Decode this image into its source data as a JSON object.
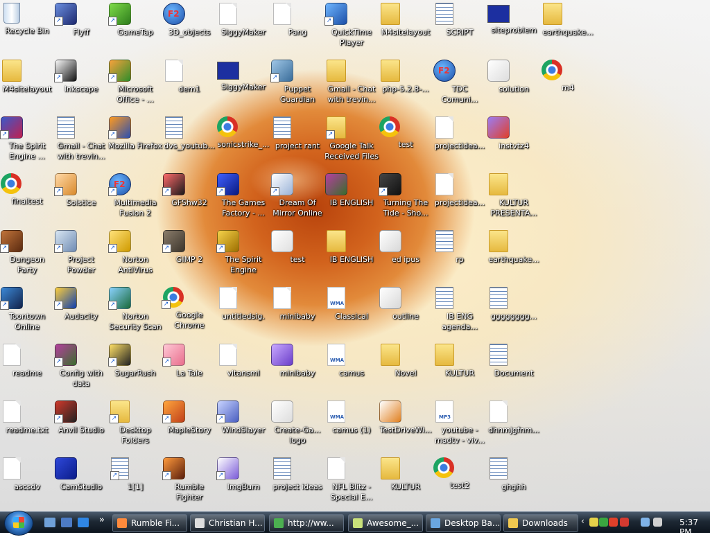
{
  "desktop": {
    "icons": [
      {
        "label": "Recycle Bin",
        "icon": "recycle-bin-icon",
        "type": "trash"
      },
      {
        "label": "Flyff",
        "icon": "flyff-icon",
        "type": "app",
        "c1": "#6b8fe0",
        "c2": "#1e2a70",
        "shortcut": true
      },
      {
        "label": "GameTap",
        "icon": "gametap-icon",
        "type": "app",
        "c1": "#7fdc4a",
        "c2": "#2e7d1c",
        "shortcut": true
      },
      {
        "label": "3D_objects",
        "icon": "multimedia-fusion-icon",
        "type": "f2"
      },
      {
        "label": "SiggyMaker",
        "icon": "file-icon",
        "type": "doc"
      },
      {
        "label": "Pang",
        "icon": "file-icon",
        "type": "doc"
      },
      {
        "label": "QuickTime Player",
        "icon": "quicktime-icon",
        "type": "app",
        "c1": "#6fb6ff",
        "c2": "#1b4fa8",
        "shortcut": true
      },
      {
        "label": "M4sitelayout",
        "icon": "zip-folder-icon",
        "type": "folder"
      },
      {
        "label": "SCRIPT",
        "icon": "text-document-icon",
        "type": "text"
      },
      {
        "label": "siteproblem",
        "icon": "bitmap-image-icon",
        "type": "dlg"
      },
      {
        "label": "earthquake...",
        "icon": "folder-icon",
        "type": "folder"
      },
      {
        "label": "M4sitelayout",
        "icon": "zip-folder-icon",
        "type": "folder"
      },
      {
        "label": "Inkscape",
        "icon": "inkscape-icon",
        "type": "app",
        "c1": "#fafafa",
        "c2": "#111111",
        "shortcut": true
      },
      {
        "label": "Microsoft Office - ...",
        "icon": "office-icon",
        "type": "app",
        "c1": "#f8a23c",
        "c2": "#2f8d2a",
        "shortcut": true
      },
      {
        "label": "dem1",
        "icon": "file-icon",
        "type": "doc"
      },
      {
        "label": "SiggyMaker",
        "icon": "siggymaker-icon",
        "type": "dlg"
      },
      {
        "label": "Puppet Guardian",
        "icon": "puppet-guardian-icon",
        "type": "app",
        "c1": "#9fc6e6",
        "c2": "#3a6d9a",
        "shortcut": true
      },
      {
        "label": "Gmail - Chat with trevin...",
        "icon": "zip-folder-icon",
        "type": "folder"
      },
      {
        "label": "php-5.2.8-...",
        "icon": "zip-folder-icon",
        "type": "folder"
      },
      {
        "label": "TDC Comuni...",
        "icon": "multimedia-fusion-icon",
        "type": "f2"
      },
      {
        "label": "solution",
        "icon": "bitmap-image-icon",
        "type": "app",
        "c1": "#ffffff",
        "c2": "#dddddd"
      },
      {
        "label": "m4",
        "icon": "chrome-icon",
        "type": "chrome"
      },
      {
        "label": "The Spirit Engine ...",
        "icon": "spirit-engine-icon",
        "type": "app",
        "c1": "#3b58c9",
        "c2": "#c02050",
        "shortcut": true
      },
      {
        "label": "Gmail - Chat with trevin...",
        "icon": "webpage-icon",
        "type": "text"
      },
      {
        "label": "Mozilla Firefox",
        "icon": "firefox-icon",
        "type": "app",
        "c1": "#ff9a1f",
        "c2": "#2b4fb0",
        "shortcut": true
      },
      {
        "label": "dvs_youtub...",
        "icon": "text-document-icon",
        "type": "text"
      },
      {
        "label": "sonicstrike_...",
        "icon": "chrome-icon",
        "type": "chrome"
      },
      {
        "label": "project rant",
        "icon": "text-document-icon",
        "type": "text"
      },
      {
        "label": "Google Talk Received Files",
        "icon": "folder-icon",
        "type": "folder",
        "shortcut": true
      },
      {
        "label": "test",
        "icon": "chrome-icon",
        "type": "chrome"
      },
      {
        "label": "projectidea...",
        "icon": "sketch-image-icon",
        "type": "doc"
      },
      {
        "label": "instvtz4",
        "icon": "installer-icon",
        "type": "app",
        "c1": "#9b7cf2",
        "c2": "#e0402a"
      },
      {
        "label": "finaltest",
        "icon": "chrome-icon",
        "type": "chrome"
      },
      {
        "label": "Solstice",
        "icon": "solstice-icon",
        "type": "app",
        "c1": "#ffd9a8",
        "c2": "#d98a2c",
        "shortcut": true
      },
      {
        "label": "Multimedia Fusion 2",
        "icon": "multimedia-fusion-icon",
        "type": "f2",
        "shortcut": true
      },
      {
        "label": "GFShw32",
        "icon": "floppy-disk-icon",
        "type": "app",
        "c1": "#ff6a6a",
        "c2": "#1a1a1a",
        "shortcut": true
      },
      {
        "label": "The Games Factory - ...",
        "icon": "games-factory-icon",
        "type": "app",
        "c1": "#3e5fff",
        "c2": "#0a1a80",
        "shortcut": true
      },
      {
        "label": "Dream Of Mirror Online",
        "icon": "dream-of-mirror-icon",
        "type": "app",
        "c1": "#ffffff",
        "c2": "#9ab3d8",
        "shortcut": true
      },
      {
        "label": "IB ENGLISH",
        "icon": "winrar-icon",
        "type": "app",
        "c1": "#b53f9e",
        "c2": "#3a6d2c"
      },
      {
        "label": "Turning The Tide - Sho...",
        "icon": "turning-tide-icon",
        "type": "app",
        "c1": "#444444",
        "c2": "#111111",
        "shortcut": true
      },
      {
        "label": "projectidea...",
        "icon": "sketch-image-icon",
        "type": "doc"
      },
      {
        "label": "KULTUR PRESENTA...",
        "icon": "folder-icon",
        "type": "folder"
      },
      {
        "label": "Dungeon Party",
        "icon": "dungeon-party-icon",
        "type": "app",
        "c1": "#c2743a",
        "c2": "#5a2a10",
        "shortcut": true
      },
      {
        "label": "Project Powder",
        "icon": "project-powder-icon",
        "type": "app",
        "c1": "#d8e6f2",
        "c2": "#6f8bb3",
        "shortcut": true
      },
      {
        "label": "Norton AntiVirus",
        "icon": "norton-icon",
        "type": "app",
        "c1": "#ffe27a",
        "c2": "#cf9a00",
        "shortcut": true
      },
      {
        "label": "GIMP 2",
        "icon": "gimp-icon",
        "type": "app",
        "c1": "#8b7d6b",
        "c2": "#3b342b",
        "shortcut": true
      },
      {
        "label": "The Spirit Engine",
        "icon": "spirit-engine-icon",
        "type": "app",
        "c1": "#f4d24a",
        "c2": "#9e6f00",
        "shortcut": true
      },
      {
        "label": "test",
        "icon": "webpage-icon",
        "type": "app",
        "c1": "#ffffff",
        "c2": "#e0e0e0"
      },
      {
        "label": "IB ENGLISH",
        "icon": "folder-icon",
        "type": "folder"
      },
      {
        "label": "ed ipus",
        "icon": "outline-icon",
        "type": "app",
        "c1": "#ffffff",
        "c2": "#d8d8d8"
      },
      {
        "label": "rp",
        "icon": "text-document-icon",
        "type": "text"
      },
      {
        "label": "earthquake...",
        "icon": "zip-folder-icon",
        "type": "folder"
      },
      {
        "label": "Toontown Online",
        "icon": "toontown-icon",
        "type": "app",
        "c1": "#3d8ad8",
        "c2": "#12224a",
        "shortcut": true
      },
      {
        "label": "Audacity",
        "icon": "audacity-icon",
        "type": "app",
        "c1": "#ffcf3a",
        "c2": "#0e3fb0",
        "shortcut": true
      },
      {
        "label": "Norton Security Scan",
        "icon": "norton-scan-icon",
        "type": "app",
        "c1": "#8ad2ff",
        "c2": "#1a6a3a",
        "shortcut": true
      },
      {
        "label": "Google Chrome",
        "icon": "chrome-icon",
        "type": "chrome",
        "shortcut": true
      },
      {
        "label": "untitledsig.",
        "icon": "image-file-icon",
        "type": "doc"
      },
      {
        "label": "minibaby",
        "icon": "file-icon",
        "type": "doc"
      },
      {
        "label": "Classical",
        "icon": "wma-file-icon",
        "type": "wma"
      },
      {
        "label": "outline",
        "icon": "outline-icon",
        "type": "app",
        "c1": "#ffffff",
        "c2": "#d8d8d8"
      },
      {
        "label": "IB ENG agenda...",
        "icon": "webpage-icon",
        "type": "text"
      },
      {
        "label": "gggggggg...",
        "icon": "text-document-icon",
        "type": "text"
      },
      {
        "label": "readme",
        "icon": "text-document-icon",
        "type": "doc"
      },
      {
        "label": "Config with data",
        "icon": "winrar-icon",
        "type": "app",
        "c1": "#b53f9e",
        "c2": "#3a6d2c",
        "shortcut": true
      },
      {
        "label": "SugarRush",
        "icon": "sugarrush-icon",
        "type": "app",
        "c1": "#ffe066",
        "c2": "#222222",
        "shortcut": true
      },
      {
        "label": "La Tale",
        "icon": "la-tale-icon",
        "type": "app",
        "c1": "#ffc9d6",
        "c2": "#e86d8c",
        "shortcut": true
      },
      {
        "label": "vitansml",
        "icon": "file-icon",
        "type": "doc"
      },
      {
        "label": "minibaby",
        "icon": "ghost-icon",
        "type": "app",
        "c1": "#c9a9ff",
        "c2": "#6a3ec9"
      },
      {
        "label": "camus",
        "icon": "wma-file-icon",
        "type": "wma"
      },
      {
        "label": "Novel",
        "icon": "zip-folder-icon",
        "type": "folder"
      },
      {
        "label": "KULTUR",
        "icon": "zip-folder-icon",
        "type": "folder"
      },
      {
        "label": "Document",
        "icon": "text-document-icon",
        "type": "text"
      },
      {
        "label": "readme.txt",
        "icon": "text-document-icon",
        "type": "doc"
      },
      {
        "label": "Anvil Studio",
        "icon": "anvil-studio-icon",
        "type": "app",
        "c1": "#d0392b",
        "c2": "#222222",
        "shortcut": true
      },
      {
        "label": "Desktop Folders",
        "icon": "folder-icon",
        "type": "folder",
        "shortcut": true
      },
      {
        "label": "MapleStory",
        "icon": "maplestory-icon",
        "type": "app",
        "c1": "#ffa63d",
        "c2": "#c0401a",
        "shortcut": true
      },
      {
        "label": "WindSlayer",
        "icon": "windslayer-icon",
        "type": "app",
        "c1": "#c8d4ff",
        "c2": "#4a5ec0",
        "shortcut": true
      },
      {
        "label": "Create-Ga... logo",
        "icon": "image-file-icon",
        "type": "app",
        "c1": "#ffffff",
        "c2": "#dddddd"
      },
      {
        "label": "camus (1)",
        "icon": "wma-file-icon",
        "type": "wma"
      },
      {
        "label": "TestDriveWi...",
        "icon": "testdrive-icon",
        "type": "app",
        "c1": "#ffffff",
        "c2": "#e08020"
      },
      {
        "label": "youtube - madtv - viv...",
        "icon": "mp3-file-icon",
        "type": "mp3"
      },
      {
        "label": "dhnmjgfnm...",
        "icon": "document-icon",
        "type": "doc"
      },
      {
        "label": "ascsdv",
        "icon": "text-document-icon",
        "type": "doc"
      },
      {
        "label": "CamStudio",
        "icon": "camstudio-icon",
        "type": "app",
        "c1": "#2e48d9",
        "c2": "#0b1c8a"
      },
      {
        "label": "1[1]",
        "icon": "text-document-icon",
        "type": "text",
        "shortcut": true
      },
      {
        "label": "Rumble Fighter",
        "icon": "rumble-fighter-icon",
        "type": "app",
        "c1": "#ff9a3c",
        "c2": "#5a1e0c",
        "shortcut": true
      },
      {
        "label": "ImgBurn",
        "icon": "imgburn-icon",
        "type": "app",
        "c1": "#ffffff",
        "c2": "#7a5ad8",
        "shortcut": true
      },
      {
        "label": "project ideas",
        "icon": "text-document-icon",
        "type": "text"
      },
      {
        "label": "NFL Blitz - Special E...",
        "icon": "file-icon",
        "type": "doc"
      },
      {
        "label": "KULTUR",
        "icon": "zip-folder-icon",
        "type": "folder"
      },
      {
        "label": "test2",
        "icon": "chrome-icon",
        "type": "chrome"
      },
      {
        "label": "ghghh",
        "icon": "text-document-icon",
        "type": "text"
      }
    ]
  },
  "taskbar": {
    "quick_launch": [
      {
        "name": "show-desktop-icon",
        "color": "#6fa0d8"
      },
      {
        "name": "switch-windows-icon",
        "color": "#4d7bc4"
      },
      {
        "name": "internet-explorer-icon",
        "color": "#2f86e4"
      }
    ],
    "more": "»",
    "buttons": [
      {
        "label": "Rumble Fi...",
        "icon": "rumble-fighter-icon",
        "color": "#ff8a3c"
      },
      {
        "label": "Christian H...",
        "icon": "chat-icon",
        "color": "#dddddd"
      },
      {
        "label": "http://ww...",
        "icon": "chrome-icon",
        "color": "#4caf50"
      },
      {
        "label": "Awesome_...",
        "icon": "notepad-icon",
        "color": "#c9e07a"
      },
      {
        "label": "Desktop Ba...",
        "icon": "control-panel-icon",
        "color": "#6aa6e0"
      },
      {
        "label": "Downloads",
        "icon": "folder-icon",
        "color": "#f0c850"
      }
    ],
    "tray": {
      "arrow": "‹",
      "icons": [
        {
          "name": "tray-app-icon-1",
          "color": "#e6d24a"
        },
        {
          "name": "tray-app-icon-2",
          "color": "#3aa640"
        },
        {
          "name": "tray-app-icon-3",
          "color": "#e0402a"
        },
        {
          "name": "gmail-notifier-icon",
          "color": "#d43a30"
        },
        {
          "name": "network-icon",
          "color": "#7fb3e8"
        },
        {
          "name": "volume-icon",
          "color": "#d0d0d0"
        }
      ],
      "clock": "5:37 PM"
    }
  }
}
